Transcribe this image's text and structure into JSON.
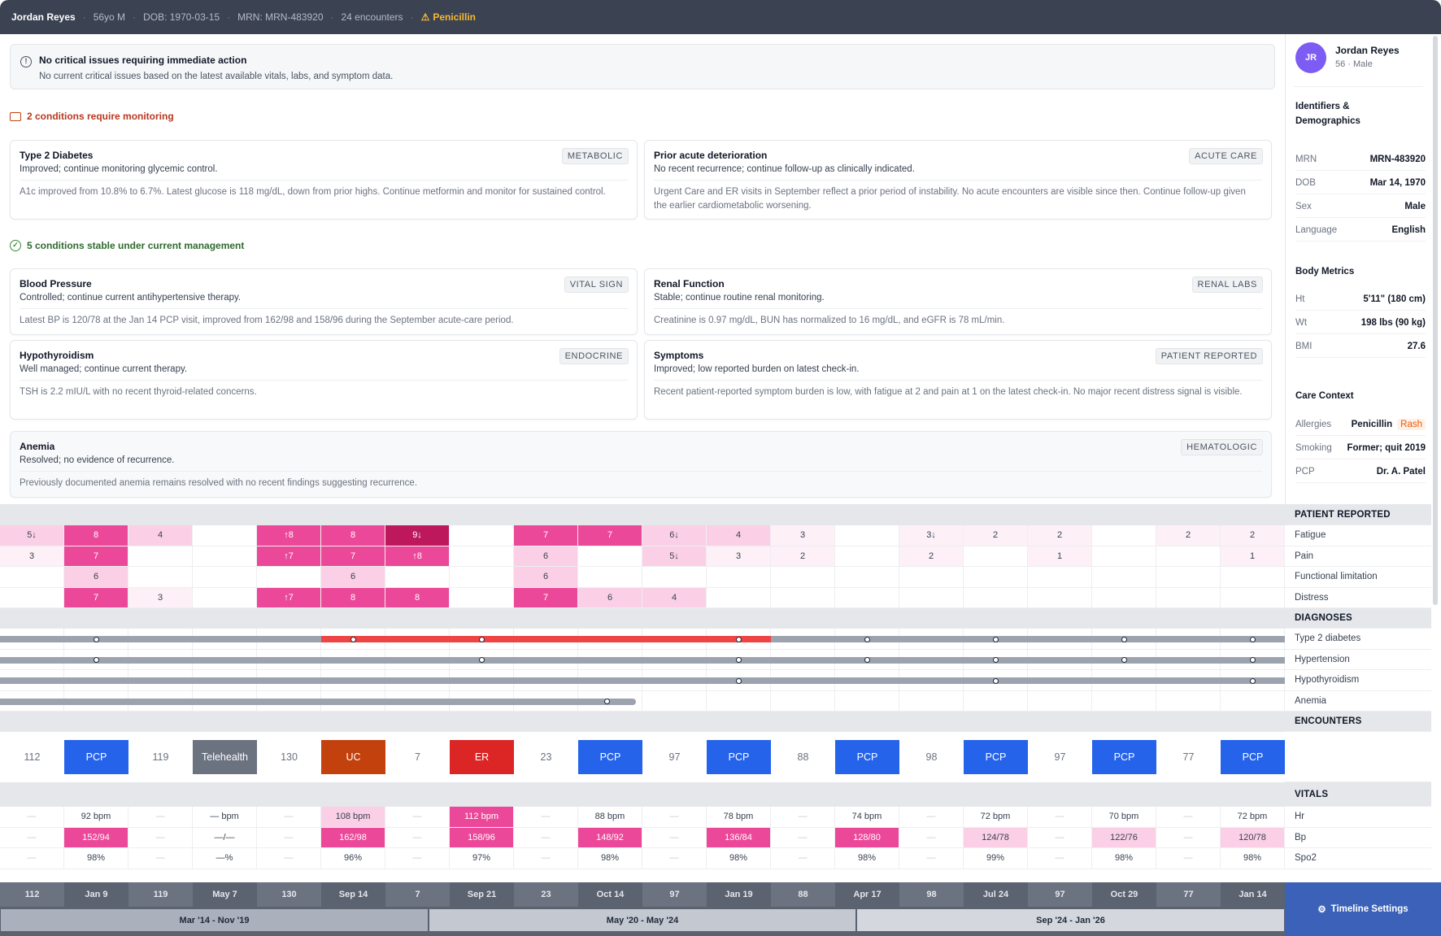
{
  "topbar": {
    "name": "Jordan Reyes",
    "age_sex": "56yo M",
    "dob": "DOB: 1970-03-15",
    "mrn": "MRN: MRN-483920",
    "encounters": "24 encounters",
    "allergy": "Penicillin"
  },
  "critical": {
    "title": "No critical issues requiring immediate action",
    "desc": "No current critical issues based on the latest available vitals, labs, and symptom data."
  },
  "monitoring_header": "2 conditions require monitoring",
  "stable_header": "5 conditions stable under current management",
  "monitoring": [
    {
      "title": "Type 2 Diabetes",
      "tag": "METABOLIC",
      "status": "Improved; continue monitoring glycemic control.",
      "detail": "A1c improved from 10.8% to 6.7%. Latest glucose is 118 mg/dL, down from prior highs. Continue metformin and monitor for sustained control."
    },
    {
      "title": "Prior acute deterioration",
      "tag": "ACUTE CARE",
      "status": "No recent recurrence; continue follow-up as clinically indicated.",
      "detail": "Urgent Care and ER visits in September reflect a prior period of instability. No acute encounters are visible since then. Continue follow-up given the earlier cardiometabolic worsening."
    }
  ],
  "stable": [
    {
      "title": "Blood Pressure",
      "tag": "VITAL SIGN",
      "status": "Controlled; continue current antihypertensive therapy.",
      "detail": "Latest BP is 120/78 at the Jan 14 PCP visit, improved from 162/98 and 158/96 during the September acute-care period."
    },
    {
      "title": "Renal Function",
      "tag": "RENAL LABS",
      "status": "Stable; continue routine renal monitoring.",
      "detail": "Creatinine is 0.97 mg/dL, BUN has normalized to 16 mg/dL, and eGFR is 78 mL/min."
    },
    {
      "title": "Hypothyroidism",
      "tag": "ENDOCRINE",
      "status": "Well managed; continue current therapy.",
      "detail": "TSH is 2.2 mIU/L with no recent thyroid-related concerns."
    },
    {
      "title": "Symptoms",
      "tag": "PATIENT REPORTED",
      "status": "Improved; low reported burden on latest check-in.",
      "detail": "Recent patient-reported symptom burden is low, with fatigue at 2 and pain at 1 on the latest check-in. No major recent distress signal is visible."
    },
    {
      "title": "Anemia",
      "tag": "HEMATOLOGIC",
      "status": "Resolved; no evidence of recurrence.",
      "detail": "Previously documented anemia remains resolved with no recent findings suggesting recurrence."
    }
  ],
  "sidebar": {
    "initials": "JR",
    "name": "Jordan Reyes",
    "meta": "56 · Male",
    "ident_header": "Identifiers & Demographics",
    "ident": [
      {
        "k": "MRN",
        "v": "MRN-483920"
      },
      {
        "k": "DOB",
        "v": "Mar 14, 1970"
      },
      {
        "k": "Sex",
        "v": "Male"
      },
      {
        "k": "Language",
        "v": "English"
      }
    ],
    "body_header": "Body Metrics",
    "body": [
      {
        "k": "Ht",
        "v": "5'11\" (180 cm)"
      },
      {
        "k": "Wt",
        "v": "198 lbs (90 kg)"
      },
      {
        "k": "BMI",
        "v": "27.6"
      }
    ],
    "care_header": "Care Context",
    "care": [
      {
        "k": "Allergies",
        "v": "Penicillin",
        "extra": "Rash"
      },
      {
        "k": "Smoking",
        "v": "Former; quit 2019"
      },
      {
        "k": "PCP",
        "v": "Dr. A. Patel"
      }
    ]
  },
  "timeline": {
    "section_labels": {
      "patient": "PATIENT REPORTED",
      "diagnoses": "DIAGNOSES",
      "encounters": "ENCOUNTERS",
      "vitals": "VITALS"
    },
    "pr_rows": [
      "Fatigue",
      "Pain",
      "Functional limitation",
      "Distress"
    ],
    "dx_rows": [
      "Type 2 diabetes",
      "Hypertension",
      "Hypothyroidism",
      "Anemia"
    ],
    "vital_rows": [
      "Hr",
      "Bp",
      "Spo2"
    ],
    "pr_values": [
      [
        "5↓",
        "8",
        "4",
        "",
        "↑8",
        "8",
        "9↓",
        "",
        "7",
        "7",
        "6↓",
        "4",
        "3",
        "",
        "3↓",
        "2",
        "2",
        "",
        "2",
        "2"
      ],
      [
        "3",
        "7",
        "",
        "",
        "↑7",
        "7",
        "↑8",
        "",
        "6",
        "",
        "5↓",
        "3",
        "2",
        "",
        "2",
        "",
        "1",
        "",
        "",
        "1"
      ],
      [
        "",
        "6",
        "",
        "",
        "",
        "6",
        "",
        "",
        "6",
        "",
        "",
        "",
        "",
        "",
        "",
        "",
        "",
        "",
        "",
        ""
      ],
      [
        "",
        "7",
        "3",
        "",
        "↑7",
        "8",
        "8",
        "",
        "7",
        "6",
        "4",
        "",
        "",
        "",
        "",
        "",
        "",
        "",
        "",
        ""
      ]
    ],
    "pr_levels": [
      [
        1,
        3,
        1,
        0,
        3,
        3,
        4,
        0,
        3,
        3,
        1,
        1,
        0.5,
        0,
        0.5,
        0.5,
        0.5,
        0,
        0.5,
        0.5
      ],
      [
        0.5,
        3,
        0,
        0,
        3,
        3,
        3,
        0,
        1,
        0,
        1,
        0.5,
        0.5,
        0,
        0.5,
        0,
        0.5,
        0,
        0,
        0.5
      ],
      [
        0,
        1,
        0,
        0,
        0,
        1,
        0,
        0,
        1,
        0,
        0,
        0,
        0,
        0,
        0,
        0,
        0,
        0,
        0,
        0
      ],
      [
        0,
        3,
        0.5,
        0,
        3,
        3,
        3,
        0,
        3,
        1,
        1,
        0,
        0,
        0,
        0,
        0,
        0,
        0,
        0,
        0
      ]
    ],
    "encounters": [
      "112",
      "PCP",
      "119",
      "Telehealth",
      "130",
      "UC",
      "7",
      "ER",
      "23",
      "PCP",
      "97",
      "PCP",
      "88",
      "PCP",
      "98",
      "PCP",
      "97",
      "PCP",
      "77",
      "PCP"
    ],
    "enc_colors": [
      "",
      "#2563eb",
      "",
      "#6b7280",
      "",
      "#c2410c",
      "",
      "#dc2626",
      "",
      "#2563eb",
      "",
      "#2563eb",
      "",
      "#2563eb",
      "",
      "#2563eb",
      "",
      "#2563eb",
      "",
      "#2563eb"
    ],
    "vitals": [
      [
        "—",
        "92 bpm",
        "—",
        "— bpm",
        "—",
        "108 bpm",
        "—",
        "112 bpm",
        "—",
        "88 bpm",
        "—",
        "78 bpm",
        "—",
        "74 bpm",
        "—",
        "72 bpm",
        "—",
        "70 bpm",
        "—",
        "72 bpm"
      ],
      [
        "—",
        "152/94",
        "—",
        "—/—",
        "—",
        "162/98",
        "—",
        "158/96",
        "—",
        "148/92",
        "—",
        "136/84",
        "—",
        "128/80",
        "—",
        "124/78",
        "—",
        "122/76",
        "—",
        "120/78"
      ],
      [
        "—",
        "98%",
        "—",
        "—%",
        "—",
        "96%",
        "—",
        "97%",
        "—",
        "98%",
        "—",
        "98%",
        "—",
        "98%",
        "—",
        "99%",
        "—",
        "98%",
        "—",
        "98%"
      ]
    ],
    "vital_levels": [
      [
        0,
        0,
        0,
        0,
        0,
        1,
        0,
        3,
        0,
        0,
        0,
        0,
        0,
        0,
        0,
        0,
        0,
        0,
        0,
        0
      ],
      [
        0,
        3,
        0,
        0,
        0,
        3,
        0,
        3,
        0,
        3,
        0,
        3,
        0,
        3,
        0,
        1,
        0,
        1,
        0,
        1
      ],
      [
        0,
        0,
        0,
        0,
        0,
        0,
        0,
        0,
        0,
        0,
        0,
        0,
        0,
        0,
        0,
        0,
        0,
        0,
        0,
        0
      ]
    ],
    "axis": [
      "112",
      "Jan 9",
      "119",
      "May 7",
      "130",
      "Sep 14",
      "7",
      "Sep 21",
      "23",
      "Oct 14",
      "97",
      "Jan 19",
      "88",
      "Apr 17",
      "98",
      "Jul 24",
      "97",
      "Oct 29",
      "77",
      "Jan 14"
    ],
    "ranges": [
      "Mar '14 - Nov '19",
      "May '20 - May '24",
      "Sep '24 - Jan '26"
    ],
    "settings_label": "Timeline Settings"
  },
  "colors": {
    "heat1": "#fbd0e6",
    "heat3": "#ec4899",
    "heat4": "#be185d",
    "heat05": "#fdf0f7",
    "red_bar": "#ef4444",
    "gray_bar": "#9ca3af"
  }
}
